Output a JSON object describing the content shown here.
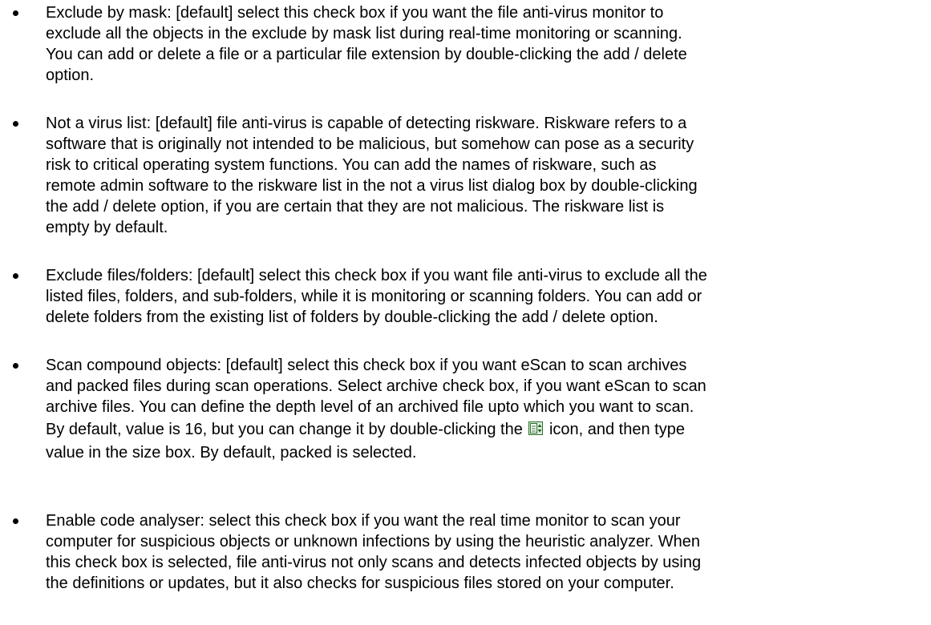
{
  "bullets": [
    {
      "lines": [
        "Exclude by mask: [default] select this check box if you want the file anti-virus monitor to",
        "exclude all the objects in the exclude by mask list during real-time monitoring or scanning.",
        "You can add or delete a file or a particular file extension by double-clicking the add / delete",
        "option."
      ]
    },
    {
      "lines": [
        "Not a virus list: [default] file anti-virus is capable of detecting riskware. Riskware refers to a",
        "software that is originally not intended to be malicious, but somehow can pose as a security",
        "risk to critical operating system functions. You can add the names of riskware, such as",
        "remote admin software to the riskware list in the not a virus list dialog box by double-clicking",
        "the add / delete option, if you are certain that they are not malicious. The riskware list is",
        "empty by default."
      ]
    },
    {
      "lines": [
        "Exclude files/folders: [default] select this check box if you want file anti-virus to exclude all the",
        "listed files, folders, and sub-folders, while it is monitoring or scanning folders. You can add or",
        "delete folders from the existing list of folders by double-clicking the add / delete option."
      ]
    },
    {
      "lines": [
        "Scan compound objects: [default] select this check box if you want eScan to scan archives",
        "and packed files during scan operations. Select archive check box, if you want eScan to scan",
        "archive files. You can define the depth level of an archived file upto which you want to scan."
      ],
      "icon_line_before": "By default, value is 16, but you can change it by double-clicking the",
      "icon_name": "spin-box-icon",
      "icon_line_after": "icon, and then type",
      "last_line": "value in the size box. By default, packed is selected."
    },
    {
      "lines": [
        "Enable code analyser: select this check box if you want the real time monitor to scan your",
        "computer for suspicious objects or unknown infections by using the heuristic analyzer. When",
        "this check box is selected, file anti-virus not only scans and detects infected objects by using",
        "the definitions or updates, but it also checks for suspicious files stored on your computer."
      ]
    }
  ],
  "icon_colors": {
    "frame": "#2c6e2c",
    "fill": "#d9ecd9",
    "arrow": "#1f5a1f"
  }
}
